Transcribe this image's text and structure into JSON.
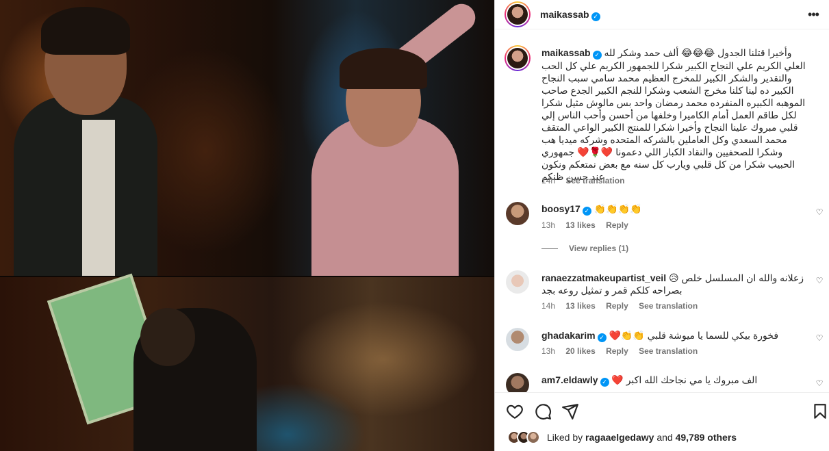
{
  "post": {
    "username": "maikassab",
    "caption_user": "maikassab",
    "caption": "وأخيرا قتلنا الجدول 😂😂😂 ألف حمد وشكر لله العلي الكريم علي النجاح الكبير شكرا للجمهور الكريم علي كل الحب والتقدير والشكر الكبير للمخرج العظيم محمد سامي سبب النجاح الكبير ده لينا كلنا مخرج الشعب وشكرا للنجم الكبير الجدع صاحب الموهبه الكبيره المنفرده محمد رمضان واحد بس مالوش مثيل شكرا لكل طاقم العمل أمام الكاميرا وخلفها من أحسن وأحب الناس إلي قلبي مبروك علينا النجاح وأخيرا شكرا للمنتج الكبير الواعي المتقف محمد السعدي وكل العاملين بالشركه المتحده وشركه ميديا هب وشكرا للصحفيين والنقاد الكبار اللي دعمونا ❤️🌹❤️ جمهوري الحبيب شكرا من كل قلبي ويارب كل سنه مع بعض نمتعكم ونكون عند حسن ظنكم",
    "caption_time": "14h",
    "see_translation": "See translation"
  },
  "comments": [
    {
      "username": "boosy17",
      "text": "👏👏👏👏",
      "time": "13h",
      "likes": "13 likes",
      "reply": "Reply",
      "view_replies": "View replies (1)"
    },
    {
      "username": "ranaezzatmakeupartist_veil",
      "text": "زعلانه والله ان المسلسل خلص 😥 بصراحه كلكم قمر و تمثيل روعه بجد",
      "time": "14h",
      "likes": "13 likes",
      "reply": "Reply",
      "see_translation": "See translation"
    },
    {
      "username": "ghadakarim",
      "text": "فخورة بيكي للسما يا ميوشة قلبي 👏👏❤️",
      "time": "13h",
      "likes": "20 likes",
      "reply": "Reply",
      "see_translation": "See translation"
    },
    {
      "username": "am7.eldawly",
      "text": "الف مبروك يا مي نجاحك الله اكبر ❤️"
    }
  ],
  "likes": {
    "prefix": "Liked by",
    "user": "ragaaelgedawy",
    "and": "and",
    "count": "49,789 others"
  },
  "icons": {
    "more": "more-options-icon",
    "heart": "heart-icon",
    "comment": "comment-icon",
    "share": "share-icon",
    "save": "save-icon",
    "verified": "verified-badge-icon"
  },
  "colors": {
    "verified": "#0095f6",
    "text": "#262626",
    "muted": "#737373",
    "divider": "#efefef"
  }
}
